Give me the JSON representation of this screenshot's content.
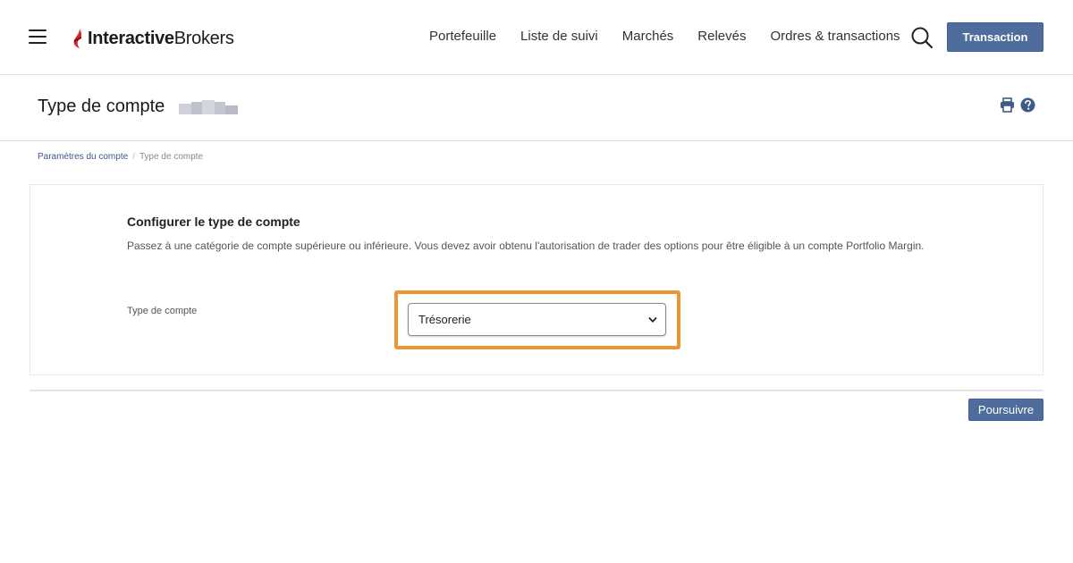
{
  "header": {
    "logo_text_bold": "Interactive",
    "logo_text_regular": "Brokers",
    "nav": [
      {
        "label": "Portefeuille"
      },
      {
        "label": "Liste de suivi"
      },
      {
        "label": "Marchés"
      },
      {
        "label": "Relevés"
      },
      {
        "label": "Ordres & transactions"
      }
    ],
    "trade_button": "Transaction"
  },
  "page": {
    "title": "Type de compte",
    "icons": [
      "print-icon",
      "help-icon"
    ]
  },
  "breadcrumb": {
    "parent": "Paramètres du compte",
    "separator": "/",
    "current": "Type de compte"
  },
  "form": {
    "title": "Configurer le type de compte",
    "description": "Passez à une catégorie de compte supérieure ou inférieure. Vous devez avoir obtenu l'autorisation de trader des options pour être éligible à un compte Portfolio Margin.",
    "field_label": "Type de compte",
    "selected_value": "Trésorerie"
  },
  "footer": {
    "continue_button": "Poursuivre"
  },
  "colors": {
    "primary_button": "#4e6d9c",
    "highlight_border": "#ef9433",
    "logo_red": "#d71f26"
  }
}
